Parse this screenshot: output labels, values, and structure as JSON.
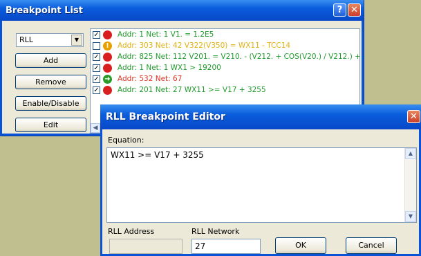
{
  "bp_window": {
    "title": "Breakpoint List",
    "help_glyph": "?",
    "close_glyph": "✕",
    "type_select": {
      "value": "RLL",
      "arrow": "▼"
    },
    "buttons": {
      "add": "Add",
      "remove": "Remove",
      "enable_disable": "Enable/Disable",
      "edit": "Edit"
    },
    "scroll_left_glyph": "◀",
    "rows": [
      {
        "checked": "✓",
        "text": "Addr: 1 Net: 1  V1. = 1.2E5",
        "color": "#1f9a2a",
        "icon": "red-dot"
      },
      {
        "checked": "",
        "text": "Addr: 303 Net: 42  V322(V350) = WX11 - TCC14",
        "color": "#e0b010",
        "icon": "warning"
      },
      {
        "checked": "✓",
        "text": "Addr: 825 Net: 112  V201. = V210. - (V212. + COS(V20.) / V212.) +",
        "color": "#1f9a2a",
        "icon": "red-dot"
      },
      {
        "checked": "✓",
        "text": "Addr: 1 Net: 1  WX1 > 19200",
        "color": "#1f9a2a",
        "icon": "red-dot"
      },
      {
        "checked": "✓",
        "text": "Addr: 532 Net: 67",
        "color": "#e03020",
        "icon": "green-arrow"
      },
      {
        "checked": "✓",
        "text": "Addr: 201 Net: 27  WX11 >= V17 + 3255",
        "color": "#1f9a2a",
        "icon": "red-dot"
      }
    ]
  },
  "editor": {
    "title": "RLL Breakpoint Editor",
    "close_glyph": "✕",
    "equation_label": "Equation:",
    "equation_value": "WX11 >= V17 + 3255",
    "address_label": "RLL Address",
    "address_value": "",
    "network_label": "RLL Network",
    "network_value": "27",
    "ok_label": "OK",
    "cancel_label": "Cancel",
    "scroll_up_glyph": "▲",
    "scroll_down_glyph": "▼"
  },
  "colors": {
    "desktop": "#bfbf8f",
    "titlebar": "#0a5ddc",
    "ok_green": "#1f9a2a",
    "warn_yellow": "#e0b010",
    "error_red": "#e03020"
  }
}
